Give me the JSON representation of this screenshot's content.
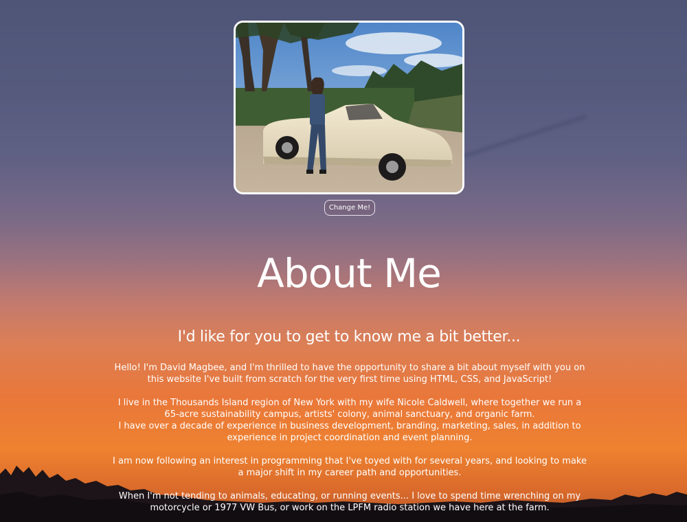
{
  "profile": {
    "photo_alt": "David Magbee leaning on a vintage convertible",
    "change_button_label": "Change Me!"
  },
  "page": {
    "title": "About Me",
    "subtitle": "I'd like for you to get to know me a bit better..."
  },
  "bio": {
    "paragraph_1": "Hello! I'm David Magbee, and I'm thrilled to have the opportunity to share a bit about myself with you on this website I've built from scratch for the very first time using HTML, CSS, and JavaScript!",
    "paragraph_2_line_1": "I live in the Thousands Island region of New York with my wife Nicole Caldwell, where together we run a 65-acre sustainability campus, artists' colony, animal sanctuary, and organic farm.",
    "paragraph_2_line_2": "I have over a decade of experience in business development, branding, marketing, sales, in addition to experience in project coordination and event planning.",
    "paragraph_3": "I am now following an interest in programming that I've toyed with for several years, and looking to make a major shift in my career path and opportunities.",
    "paragraph_4": "When I'm not tending to animals, educating, or running events... I love to spend time wrenching on my motorcycle or 1977 VW Bus, or work on the LPFM radio station we have here at the farm."
  },
  "colors": {
    "sky_top": "#4e5577",
    "sunset_orange": "#ee8230",
    "text": "#ffffff"
  }
}
